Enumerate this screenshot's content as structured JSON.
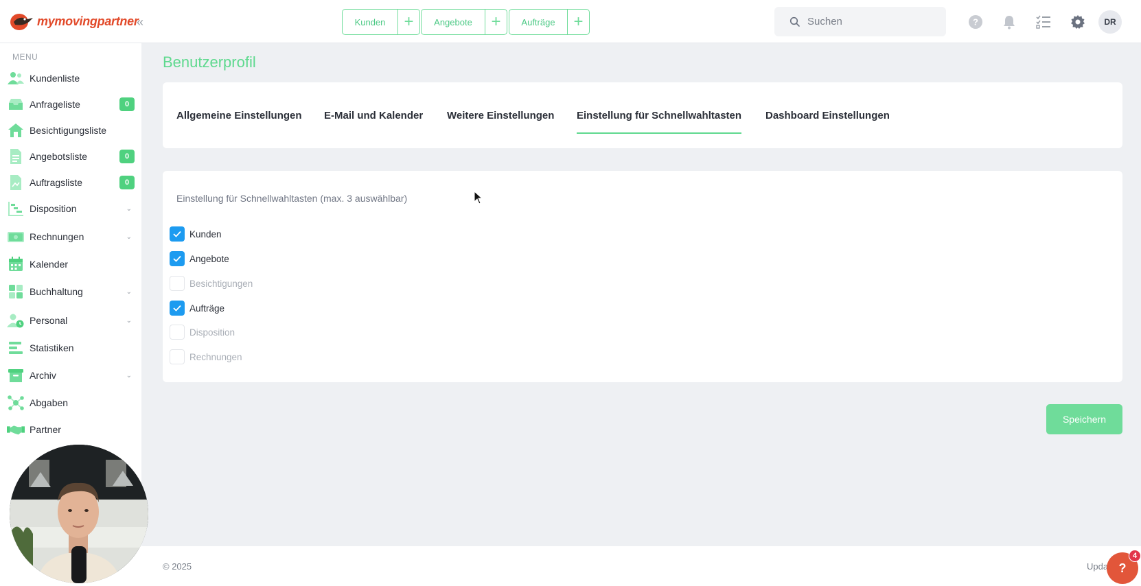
{
  "brand": {
    "name_part1": "my",
    "name_part2": "moving",
    "name_part3": "partner"
  },
  "topbar": {
    "quick_buttons": [
      {
        "label": "Kunden"
      },
      {
        "label": "Angebote"
      },
      {
        "label": "Aufträge"
      }
    ],
    "search_placeholder": "Suchen",
    "avatar_initials": "DR"
  },
  "sidebar": {
    "menu_label": "MENU",
    "items": [
      {
        "label": "Kundenliste",
        "icon": "users-icon"
      },
      {
        "label": "Anfrageliste",
        "icon": "inbox-icon",
        "badge": "0"
      },
      {
        "label": "Besichtigungsliste",
        "icon": "house-icon"
      },
      {
        "label": "Angebotsliste",
        "icon": "document-icon",
        "badge": "0"
      },
      {
        "label": "Auftragsliste",
        "icon": "file-icon",
        "badge": "0"
      },
      {
        "label": "Disposition",
        "icon": "chart-steps-icon"
      },
      {
        "label": "Rechnungen",
        "icon": "money-icon"
      },
      {
        "label": "Kalender",
        "icon": "calendar-icon"
      },
      {
        "label": "Buchhaltung",
        "icon": "grid-icon"
      },
      {
        "label": "Personal",
        "icon": "person-clock-icon"
      },
      {
        "label": "Statistiken",
        "icon": "bars-icon"
      },
      {
        "label": "Archiv",
        "icon": "archive-icon"
      },
      {
        "label": "Abgaben",
        "icon": "network-icon"
      },
      {
        "label": "Partner",
        "icon": "handshake-icon"
      }
    ]
  },
  "main": {
    "page_title": "Benutzerprofil",
    "tabs": [
      {
        "label": "Allgemeine Einstellungen"
      },
      {
        "label": "E-Mail und Kalender"
      },
      {
        "label": "Weitere Einstellungen"
      },
      {
        "label": "Einstellung für Schnellwahltasten",
        "active": true
      },
      {
        "label": "Dashboard Einstellungen"
      }
    ],
    "section_title": "Einstellung für Schnellwahltasten (max. 3 auswählbar)",
    "options": [
      {
        "label": "Kunden",
        "checked": true
      },
      {
        "label": "Angebote",
        "checked": true
      },
      {
        "label": "Besichtigungen",
        "checked": false
      },
      {
        "label": "Aufträge",
        "checked": true
      },
      {
        "label": "Disposition",
        "checked": false
      },
      {
        "label": "Rechnungen",
        "checked": false
      }
    ],
    "save_label": "Speichern"
  },
  "footer": {
    "copyright": "© 2025",
    "update_text": "Upda"
  },
  "help": {
    "label": "?",
    "badge": "4"
  },
  "colors": {
    "accent": "#5ed98e",
    "brand": "#e24a2a",
    "checkbox": "#1d9bf0"
  }
}
